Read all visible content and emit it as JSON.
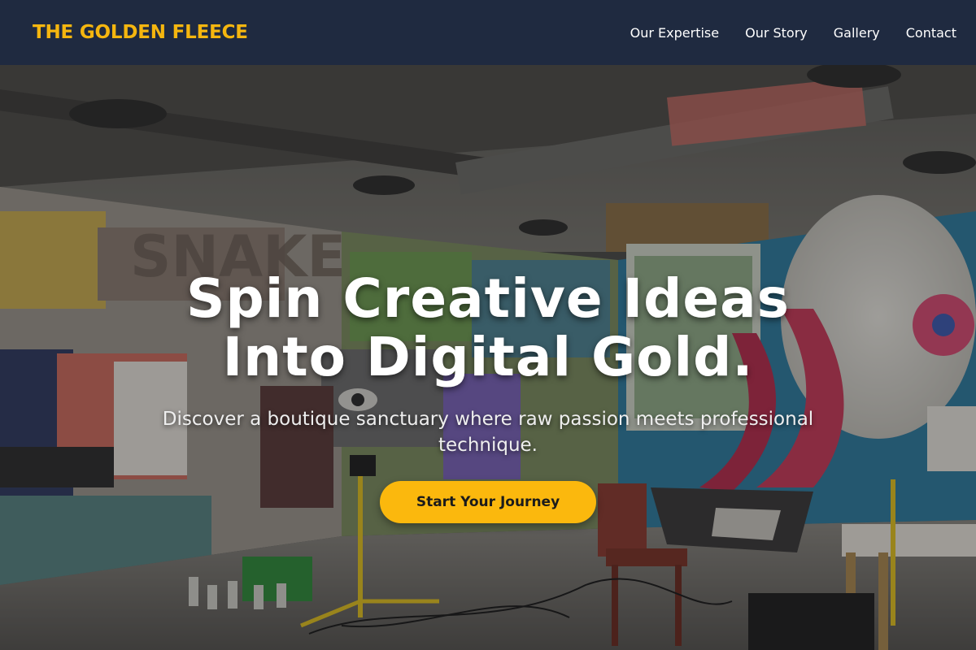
{
  "nav": {
    "brand": "THE GOLDEN FLEECE",
    "links": [
      "Our Expertise",
      "Our Story",
      "Gallery",
      "Contact"
    ]
  },
  "hero": {
    "title_line1": "Spin Creative Ideas",
    "title_line2": "Into Digital Gold.",
    "subtitle": "Discover a boutique sanctuary where raw passion meets professional technique.",
    "cta_label": "Start Your Journey",
    "background_description_icon": "graffiti-studio-photo"
  },
  "colors": {
    "nav_bg": "#1f2a40",
    "brand": "#f5b60f",
    "cta_bg": "#fbb80d",
    "nav_text": "#ffffff"
  }
}
